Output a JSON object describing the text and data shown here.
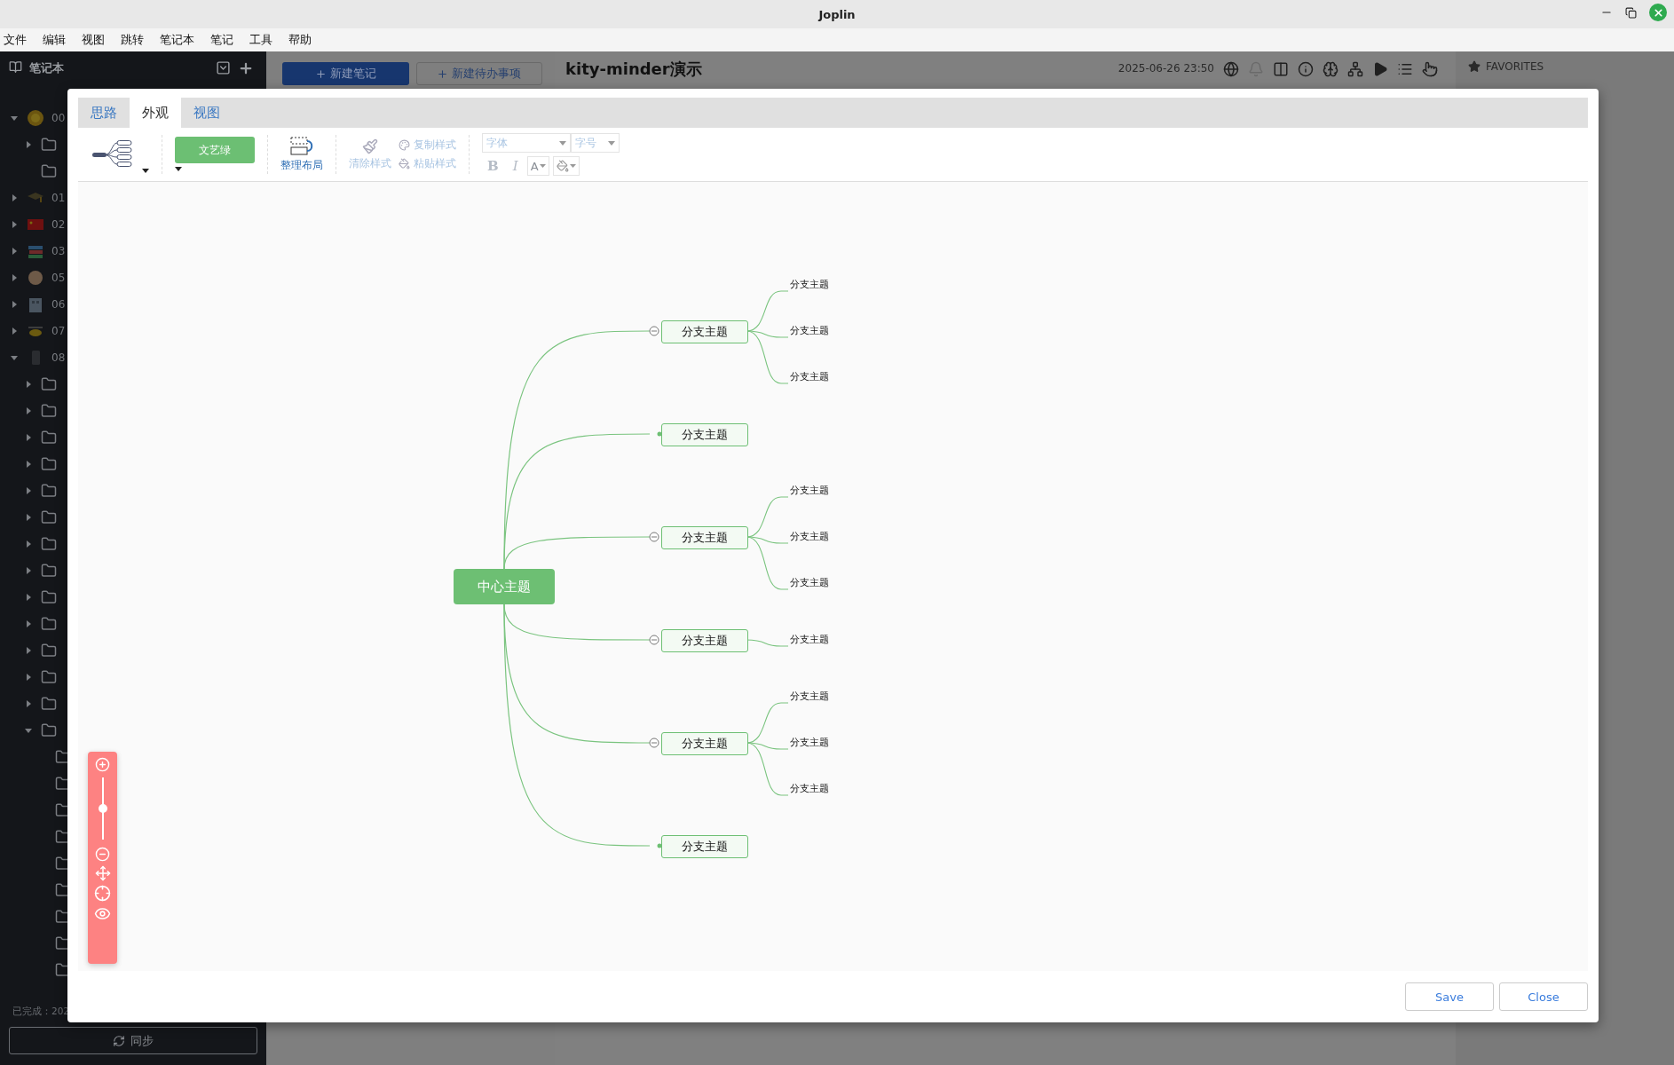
{
  "window": {
    "title": "Joplin"
  },
  "menu": [
    "文件",
    "编辑",
    "视图",
    "跳转",
    "笔记本",
    "笔记",
    "工具",
    "帮助"
  ],
  "sidebar": {
    "title": "笔记本",
    "items": [
      {
        "kind": "notebook",
        "label": "00",
        "expanded": true,
        "children": [
          {
            "kind": "folder",
            "expanded": false
          },
          {
            "kind": "folder"
          }
        ]
      },
      {
        "kind": "notebook",
        "label": "01",
        "expanded": false
      },
      {
        "kind": "notebook",
        "label": "02",
        "expanded": false
      },
      {
        "kind": "notebook",
        "label": "03",
        "expanded": false
      },
      {
        "kind": "notebook",
        "label": "05",
        "expanded": false
      },
      {
        "kind": "notebook",
        "label": "06",
        "expanded": false
      },
      {
        "kind": "notebook",
        "label": "07",
        "expanded": false
      },
      {
        "kind": "notebook",
        "label": "08",
        "expanded": true,
        "children": [
          {
            "kind": "folder",
            "expanded": false
          },
          {
            "kind": "folder",
            "expanded": false
          },
          {
            "kind": "folder",
            "expanded": false
          },
          {
            "kind": "folder",
            "expanded": false
          },
          {
            "kind": "folder",
            "expanded": false
          },
          {
            "kind": "folder",
            "expanded": false
          },
          {
            "kind": "folder",
            "expanded": false
          },
          {
            "kind": "folder",
            "expanded": false
          },
          {
            "kind": "folder",
            "expanded": false
          },
          {
            "kind": "folder",
            "expanded": false
          },
          {
            "kind": "folder",
            "expanded": false
          },
          {
            "kind": "folder",
            "expanded": false
          },
          {
            "kind": "folder",
            "expanded": false
          },
          {
            "kind": "folder",
            "expanded": true,
            "children": [
              {
                "kind": "folder"
              },
              {
                "kind": "folder"
              },
              {
                "kind": "folder"
              },
              {
                "kind": "folder"
              },
              {
                "kind": "folder"
              },
              {
                "kind": "folder"
              },
              {
                "kind": "folder"
              },
              {
                "kind": "folder"
              },
              {
                "kind": "folder"
              }
            ]
          }
        ]
      }
    ],
    "status": "已完成：202",
    "sync_button": "同步"
  },
  "note_list": {
    "new_note": "新建笔记",
    "new_todo": "新建待办事项"
  },
  "note": {
    "title": "kity-minder演示",
    "date": "2025-06-26 23:50"
  },
  "right_panel": {
    "title": "FAVORITES"
  },
  "dialog": {
    "tabs": [
      {
        "label": "思路",
        "selected": false
      },
      {
        "label": "外观",
        "selected": true
      },
      {
        "label": "视图",
        "selected": false
      }
    ],
    "theme": "文艺绿",
    "layout_button": {
      "label": "整理布局",
      "disabled": false
    },
    "clear_style": {
      "label": "清除样式",
      "disabled": true
    },
    "style_tools": [
      {
        "label": "复制样式",
        "disabled": true
      },
      {
        "label": "粘贴样式",
        "disabled": true
      }
    ],
    "font_placeholder": "字体",
    "size_placeholder": "字号",
    "format_buttons": [
      "B",
      "I"
    ],
    "font_color_button": "A",
    "mindmap": {
      "root": "中心主题",
      "branches": [
        {
          "label": "分支主题",
          "children": [
            "分支主题",
            "分支主题",
            "分支主题"
          ]
        },
        {
          "label": "分支主题"
        },
        {
          "label": "分支主题",
          "children": [
            "分支主题",
            "分支主题",
            "分支主题"
          ]
        },
        {
          "label": "分支主题",
          "children": [
            "分支主题"
          ]
        },
        {
          "label": "分支主题",
          "children": [
            "分支主题",
            "分支主题",
            "分支主题"
          ]
        },
        {
          "label": "分支主题"
        }
      ]
    },
    "zoom": {
      "level": 0.5
    },
    "buttons": [
      "Save",
      "Close"
    ]
  }
}
